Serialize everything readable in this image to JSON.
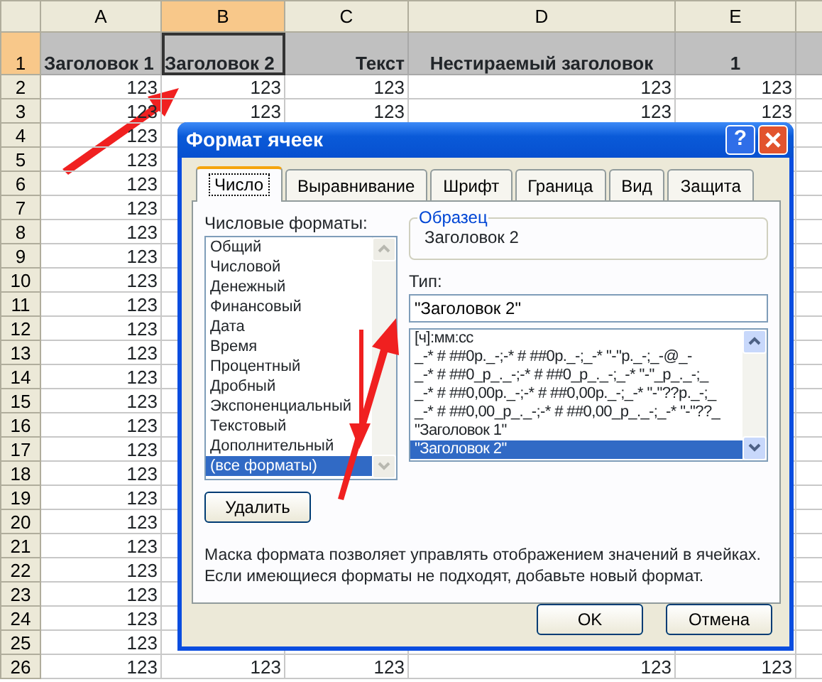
{
  "spreadsheet": {
    "columns": [
      {
        "label": "A",
        "selected": false
      },
      {
        "label": "B",
        "selected": true
      },
      {
        "label": "C",
        "selected": false
      },
      {
        "label": "D",
        "selected": false
      },
      {
        "label": "E",
        "selected": false
      }
    ],
    "rows": [
      {
        "number": "1",
        "kind": "header",
        "selected": true,
        "cells": [
          "Заголовок 1",
          "Заголовок 2",
          "Текст",
          "Нестираемый заголовок",
          "1"
        ]
      },
      {
        "number": "2",
        "kind": "data",
        "selected": false,
        "cells": [
          "123",
          "123",
          "123",
          "123",
          "123"
        ]
      },
      {
        "number": "3",
        "kind": "data",
        "selected": false,
        "cells": [
          "123",
          "123",
          "123",
          "123",
          "123"
        ]
      },
      {
        "number": "4",
        "kind": "data",
        "selected": false,
        "cells": [
          "123"
        ]
      },
      {
        "number": "5",
        "kind": "data",
        "selected": false,
        "cells": [
          "123"
        ]
      },
      {
        "number": "6",
        "kind": "data",
        "selected": false,
        "cells": [
          "123"
        ]
      },
      {
        "number": "7",
        "kind": "data",
        "selected": false,
        "cells": [
          "123"
        ]
      },
      {
        "number": "8",
        "kind": "data",
        "selected": false,
        "cells": [
          "123"
        ]
      },
      {
        "number": "9",
        "kind": "data",
        "selected": false,
        "cells": [
          "123"
        ]
      },
      {
        "number": "10",
        "kind": "data",
        "selected": false,
        "cells": [
          "123"
        ]
      },
      {
        "number": "11",
        "kind": "data",
        "selected": false,
        "cells": [
          "123"
        ]
      },
      {
        "number": "12",
        "kind": "data",
        "selected": false,
        "cells": [
          "123"
        ]
      },
      {
        "number": "13",
        "kind": "data",
        "selected": false,
        "cells": [
          "123"
        ]
      },
      {
        "number": "14",
        "kind": "data",
        "selected": false,
        "cells": [
          "123"
        ]
      },
      {
        "number": "15",
        "kind": "data",
        "selected": false,
        "cells": [
          "123"
        ]
      },
      {
        "number": "16",
        "kind": "data",
        "selected": false,
        "cells": [
          "123"
        ]
      },
      {
        "number": "17",
        "kind": "data",
        "selected": false,
        "cells": [
          "123"
        ]
      },
      {
        "number": "18",
        "kind": "data",
        "selected": false,
        "cells": [
          "123"
        ]
      },
      {
        "number": "19",
        "kind": "data",
        "selected": false,
        "cells": [
          "123"
        ]
      },
      {
        "number": "20",
        "kind": "data",
        "selected": false,
        "cells": [
          "123"
        ]
      },
      {
        "number": "21",
        "kind": "data",
        "selected": false,
        "cells": [
          "123"
        ]
      },
      {
        "number": "22",
        "kind": "data",
        "selected": false,
        "cells": [
          "123"
        ]
      },
      {
        "number": "23",
        "kind": "data",
        "selected": false,
        "cells": [
          "123"
        ]
      },
      {
        "number": "24",
        "kind": "data",
        "selected": false,
        "cells": [
          "123"
        ]
      },
      {
        "number": "25",
        "kind": "data",
        "selected": false,
        "cells": [
          "123"
        ]
      },
      {
        "number": "26",
        "kind": "data",
        "selected": false,
        "cells": [
          "123",
          "123",
          "123",
          "123",
          "123"
        ]
      }
    ]
  },
  "dialog": {
    "title": "Формат ячеек",
    "help": "?",
    "tabs": [
      {
        "label": "Число",
        "selected": true
      },
      {
        "label": "Выравнивание",
        "selected": false
      },
      {
        "label": "Шрифт",
        "selected": false
      },
      {
        "label": "Граница",
        "selected": false
      },
      {
        "label": "Вид",
        "selected": false
      },
      {
        "label": "Защита",
        "selected": false
      }
    ],
    "categories_label": "Числовые форматы:",
    "categories": [
      {
        "label": "Общий",
        "selected": false
      },
      {
        "label": "Числовой",
        "selected": false
      },
      {
        "label": "Денежный",
        "selected": false
      },
      {
        "label": "Финансовый",
        "selected": false
      },
      {
        "label": "Дата",
        "selected": false
      },
      {
        "label": "Время",
        "selected": false
      },
      {
        "label": "Процентный",
        "selected": false
      },
      {
        "label": "Дробный",
        "selected": false
      },
      {
        "label": "Экспоненциальный",
        "selected": false
      },
      {
        "label": "Текстовый",
        "selected": false
      },
      {
        "label": "Дополнительный",
        "selected": false
      },
      {
        "label": "(все форматы)",
        "selected": true
      }
    ],
    "sample": {
      "legend": "Образец",
      "value": "Заголовок 2"
    },
    "type_label": "Тип:",
    "type_value": "\"Заголовок 2\"",
    "formats": [
      {
        "label": "[ч]:мм:сс",
        "selected": false
      },
      {
        "label": "_-* # ##0р._-;-* # ##0р._-;_-* \"-\"р._-;_-@_-",
        "selected": false
      },
      {
        "label": "_-* # ##0_р_._-;-* # ##0_р_._-;_-* \"-\"_р_._-;_",
        "selected": false
      },
      {
        "label": "_-* # ##0,00р._-;-* # ##0,00р._-;_-* \"-\"??р._-;_",
        "selected": false
      },
      {
        "label": "_-* # ##0,00_р_._-;-* # ##0,00_р_._-;_-* \"-\"??_",
        "selected": false
      },
      {
        "label": "\"Заголовок 1\"",
        "selected": false
      },
      {
        "label": "\"Заголовок 2\"",
        "selected": true
      }
    ],
    "delete_button": "Удалить",
    "description": "Маска формата позволяет управлять отображением значений в ячейках. Если имеющиеся форматы не подходят, добавьте новый формат.",
    "buttons": [
      "OK",
      "Отмена"
    ]
  }
}
